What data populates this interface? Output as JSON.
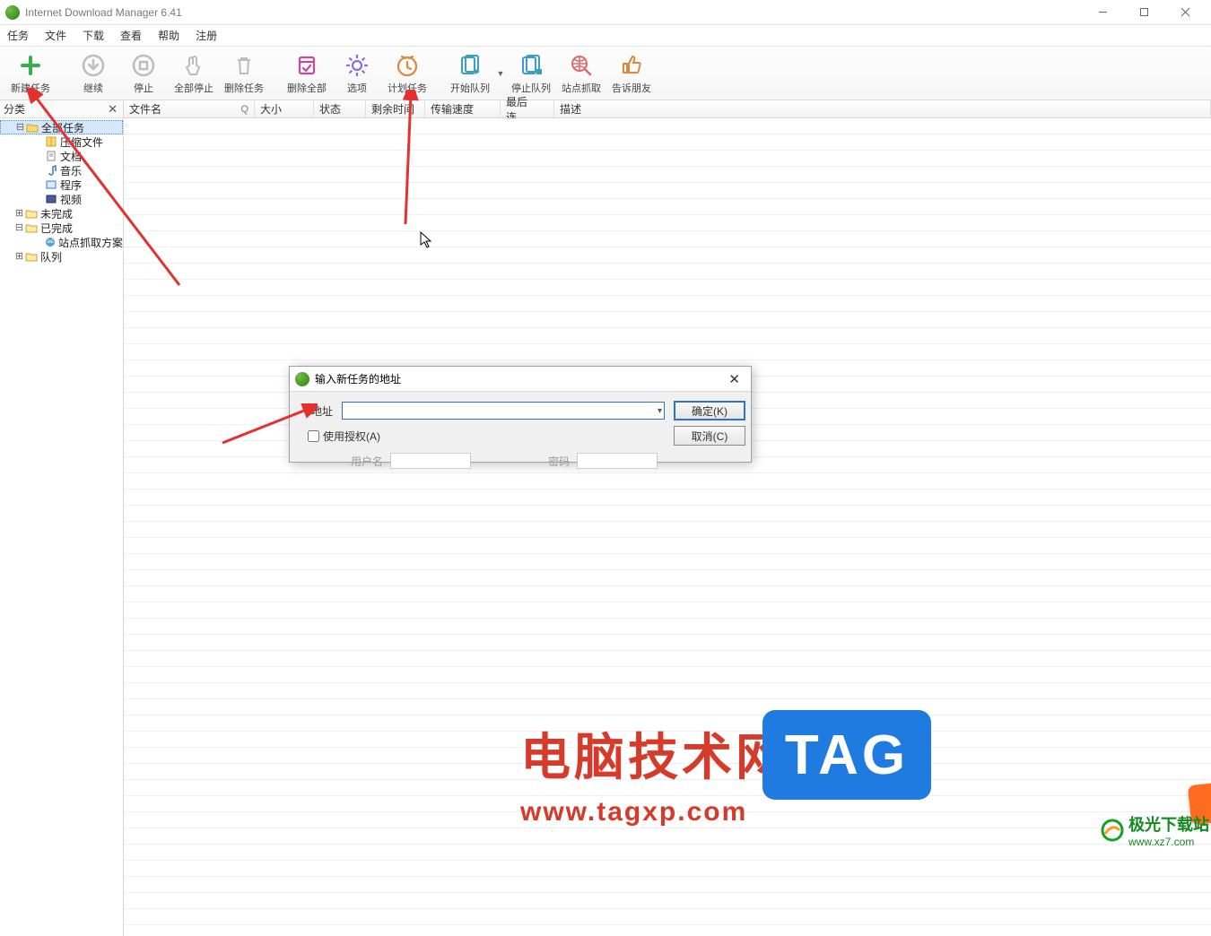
{
  "titlebar": {
    "title": "Internet Download Manager 6.41"
  },
  "menubar": {
    "items": [
      "任务",
      "文件",
      "下载",
      "查看",
      "帮助",
      "注册"
    ]
  },
  "toolbar": {
    "buttons": [
      {
        "key": "new",
        "label": "新建任务",
        "color": "#35b04a",
        "icon": "plus"
      },
      {
        "key": "resume",
        "label": "继续",
        "color": "#bdbdbd",
        "icon": "down-circle"
      },
      {
        "key": "stop",
        "label": "停止",
        "color": "#bdbdbd",
        "icon": "square-circle"
      },
      {
        "key": "stop-all",
        "label": "全部停止",
        "color": "#bdbdbd",
        "icon": "hand"
      },
      {
        "key": "delete",
        "label": "删除任务",
        "color": "#bdbdbd",
        "icon": "trash"
      },
      {
        "key": "delete-all",
        "label": "删除全部",
        "color": "#c24b9a",
        "icon": "trash-check"
      },
      {
        "key": "options",
        "label": "选项",
        "color": "#8a6de0",
        "icon": "gear"
      },
      {
        "key": "schedule",
        "label": "计划任务",
        "color": "#d98a3a",
        "icon": "clock"
      },
      {
        "key": "start-queue",
        "label": "开始队列",
        "color": "#3aa0c2",
        "icon": "queue-play"
      },
      {
        "key": "stop-queue",
        "label": "停止队列",
        "color": "#3aa0c2",
        "icon": "queue-stop"
      },
      {
        "key": "grabber",
        "label": "站点抓取",
        "color": "#d96a6a",
        "icon": "grab"
      },
      {
        "key": "tell",
        "label": "告诉朋友",
        "color": "#d98a3a",
        "icon": "thumb"
      }
    ]
  },
  "sidebar": {
    "header": "分类",
    "close": "✕",
    "tree": [
      {
        "label": "全部任务",
        "icon": "folder-open",
        "expand": "⊟",
        "indent": 1,
        "selected": true
      },
      {
        "label": "压缩文件",
        "icon": "archive",
        "indent": 2
      },
      {
        "label": "文档",
        "icon": "doc",
        "indent": 2
      },
      {
        "label": "音乐",
        "icon": "music",
        "indent": 2
      },
      {
        "label": "程序",
        "icon": "app",
        "indent": 2
      },
      {
        "label": "视频",
        "icon": "video",
        "indent": 2
      },
      {
        "label": "未完成",
        "icon": "folder",
        "expand": "⊞",
        "indent": 1
      },
      {
        "label": "已完成",
        "icon": "folder",
        "expand": "⊟",
        "indent": 1
      },
      {
        "label": "站点抓取方案",
        "icon": "ie",
        "indent": 2
      },
      {
        "label": "队列",
        "icon": "folder",
        "expand": "⊞",
        "indent": 1
      }
    ]
  },
  "columns": {
    "name": "文件名",
    "q": "Q",
    "size": "大小",
    "status": "状态",
    "remain": "剩余时间",
    "speed": "传输速度",
    "last": "最后连…",
    "desc": "描述"
  },
  "dialog": {
    "title": "输入新任务的地址",
    "close": "✕",
    "url_label": "地址",
    "auth_label": "使用授权(A)",
    "user_label": "用户名",
    "pass_label": "密码",
    "ok_label": "确定(K)",
    "cancel_label": "取消(C)"
  },
  "watermark": {
    "line1": "电脑技术网",
    "line2": "www.tagxp.com",
    "tag": "TAG",
    "site2_name": "极光下载站",
    "site2_url": "www.xz7.com"
  }
}
